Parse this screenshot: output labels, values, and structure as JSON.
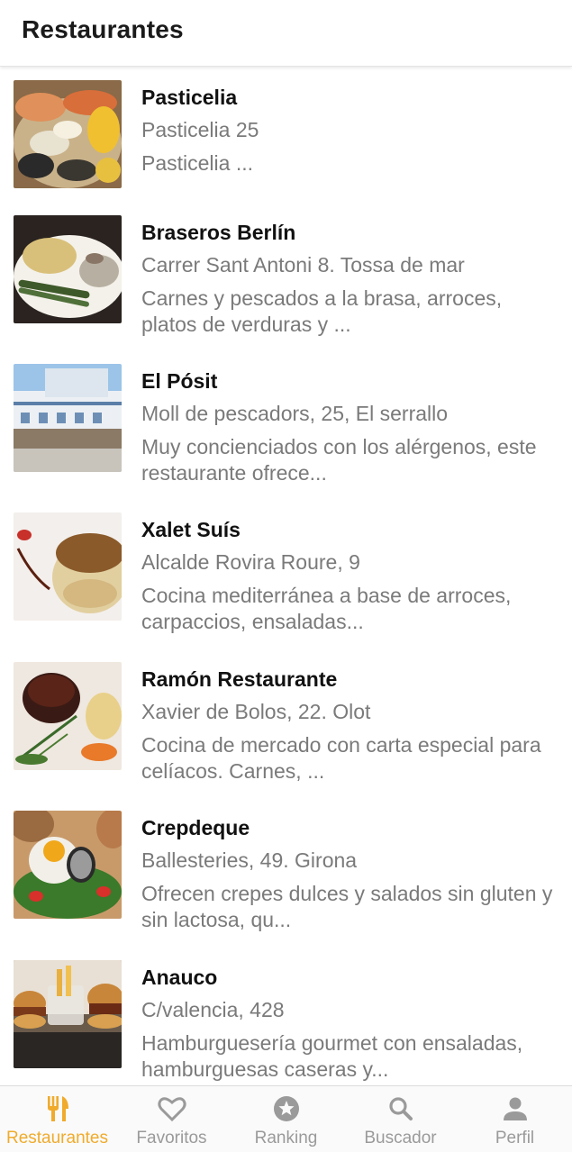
{
  "header": {
    "title": "Restaurantes"
  },
  "restaurants": [
    {
      "name": "Pasticelia",
      "address": "Pasticelia 25",
      "description": "Pasticelia ..."
    },
    {
      "name": "Braseros Berlín",
      "address": "Carrer Sant Antoni 8. Tossa de mar",
      "description": "Carnes y pescados a la brasa, arroces, platos de verduras y ..."
    },
    {
      "name": "El Pósit",
      "address": "Moll de pescadors, 25, El serrallo",
      "description": "Muy concienciados con los alérgenos, este restaurante ofrece..."
    },
    {
      "name": "Xalet Suís",
      "address": "Alcalde Rovira Roure, 9",
      "description": "Cocina mediterránea a base de arroces, carpaccios, ensaladas..."
    },
    {
      "name": "Ramón Restaurante",
      "address": "Xavier de Bolos, 22. Olot",
      "description": "Cocina de mercado con carta especial para celíacos. Carnes, ..."
    },
    {
      "name": "Crepdeque",
      "address": "Ballesteries, 49. Girona",
      "description": "Ofrecen crepes dulces y salados sin gluten y sin lactosa, qu..."
    },
    {
      "name": "Anauco",
      "address": "C/valencia, 428",
      "description": "Hamburguesería gourmet con ensaladas, hamburguesas caseras y..."
    }
  ],
  "tabs": [
    {
      "label": "Restaurantes",
      "icon": "fork-knife-icon",
      "active": true
    },
    {
      "label": "Favoritos",
      "icon": "heart-icon",
      "active": false
    },
    {
      "label": "Ranking",
      "icon": "star-icon",
      "active": false
    },
    {
      "label": "Buscador",
      "icon": "search-icon",
      "active": false
    },
    {
      "label": "Perfil",
      "icon": "person-icon",
      "active": false
    }
  ],
  "colors": {
    "accent": "#f0ab2c",
    "inactive": "#9a9a9a",
    "secondary_text": "#7a7a7a"
  }
}
